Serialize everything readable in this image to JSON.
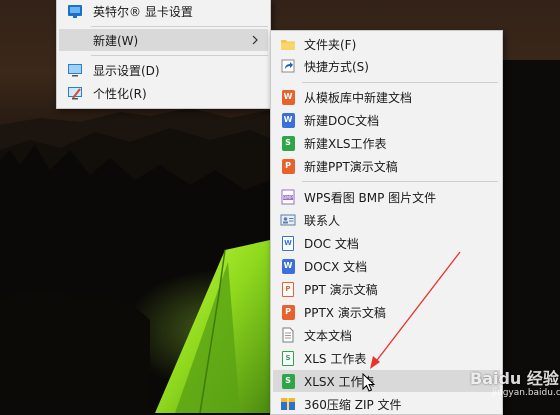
{
  "context_menu": {
    "items": [
      {
        "label": "英特尔® 显卡设置",
        "icon": "intel-graphics-icon"
      },
      {
        "label": "新建(W)",
        "icon": "none",
        "submenu": true
      },
      {
        "label": "显示设置(D)",
        "icon": "display-settings-icon"
      },
      {
        "label": "个性化(R)",
        "icon": "personalize-icon"
      }
    ]
  },
  "new_submenu": {
    "items": [
      {
        "label": "文件夹(F)",
        "icon": "folder-icon"
      },
      {
        "label": "快捷方式(S)",
        "icon": "shortcut-icon"
      },
      {
        "label": "从模板库中新建文档",
        "icon": "template-icon"
      },
      {
        "label": "新建DOC文档",
        "icon": "wps-writer-icon"
      },
      {
        "label": "新建XLS工作表",
        "icon": "wps-sheet-icon"
      },
      {
        "label": "新建PPT演示文稿",
        "icon": "wps-presentation-icon"
      },
      {
        "label": "WPS看图 BMP 图片文件",
        "icon": "bmp-image-icon"
      },
      {
        "label": "联系人",
        "icon": "contact-icon"
      },
      {
        "label": "DOC 文档",
        "icon": "doc-file-icon"
      },
      {
        "label": "DOCX 文档",
        "icon": "docx-file-icon"
      },
      {
        "label": "PPT 演示文稿",
        "icon": "ppt-file-icon"
      },
      {
        "label": "PPTX 演示文稿",
        "icon": "pptx-file-icon"
      },
      {
        "label": "文本文档",
        "icon": "text-file-icon"
      },
      {
        "label": "XLS 工作表",
        "icon": "xls-file-icon"
      },
      {
        "label": "XLSX 工作表",
        "icon": "xlsx-file-icon",
        "highlighted": true
      },
      {
        "label": "360压缩 ZIP 文件",
        "icon": "zip-archive-icon"
      }
    ]
  },
  "watermark": {
    "text": "Baidu 经验",
    "sub": "jingyan.baidu.com"
  },
  "colors": {
    "menu_bg": "#f2f2f2",
    "highlight": "#d9d9d9",
    "arrow": "#e8322a",
    "writer_blue": "#3b6fd9",
    "sheet_green": "#2fa54a",
    "presentation_orange": "#e8632c"
  }
}
